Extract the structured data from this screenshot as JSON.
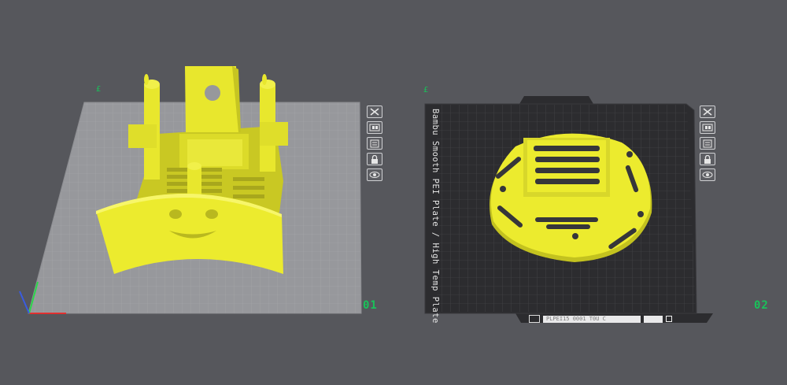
{
  "plates": [
    {
      "number": "01",
      "marker": "£"
    },
    {
      "number": "02",
      "marker": "£"
    }
  ],
  "plate2": {
    "label": "Bambu Smooth PEI Plate / High Temp Plate",
    "bottom_strip_text": "PLPEI15 0001 T0U C",
    "bottom_chip_text": "",
    "bottom_tab_logo": "bambu-logo-icon"
  },
  "plate_controls": [
    {
      "name": "close-plate-button",
      "icon": "close-icon"
    },
    {
      "name": "arrange-plate-button",
      "icon": "arrange-icon"
    },
    {
      "name": "slice-plate-button",
      "icon": "plate-settings-icon"
    },
    {
      "name": "lock-plate-button",
      "icon": "lock-icon"
    },
    {
      "name": "plate-view-button",
      "icon": "eye-icon"
    }
  ],
  "colors": {
    "background": "#56575c",
    "plate1": "#97989c",
    "plate2": "#2c2c2f",
    "model": "#e6e52a",
    "plate_number": "#19c25a"
  }
}
